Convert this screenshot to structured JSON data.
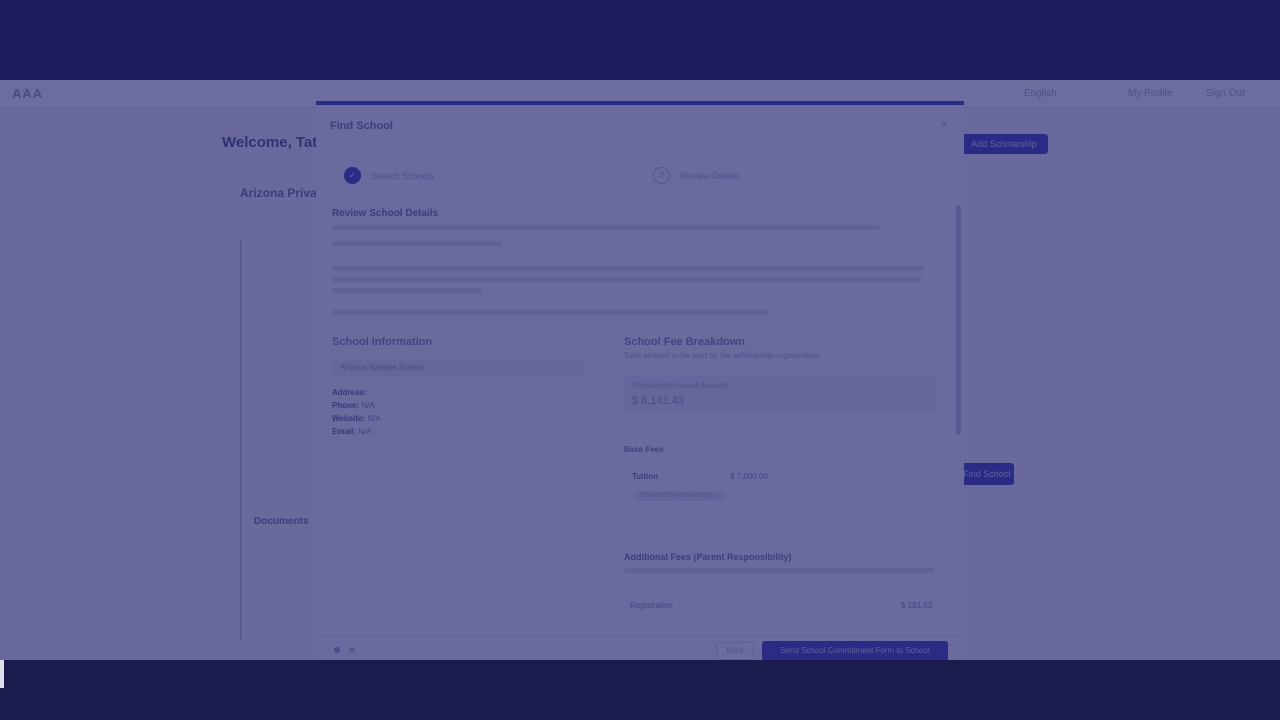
{
  "app": {
    "logo": "AAA",
    "nav": [
      "English",
      "My Profile",
      "Sign Out"
    ],
    "welcome": "Welcome, Tate",
    "add_scholarship_label": "Add Scholarship",
    "find_school_label": "Find School",
    "program_title": "Arizona Private",
    "documents_title": "Documents"
  },
  "modal": {
    "title": "Find School",
    "close": "×",
    "steps": [
      {
        "label": "Search Schools",
        "icon": "✓",
        "state": "done"
      },
      {
        "label": "Review Details",
        "icon": "2",
        "state": "todo"
      }
    ],
    "review_heading": "Review School Details",
    "school_info_title": "School Information",
    "school_name": "Arizona Sample School",
    "info": [
      {
        "label": "Address:",
        "value": ""
      },
      {
        "label": "Phone:",
        "value": "N/A"
      },
      {
        "label": "Website:",
        "value": "N/A"
      },
      {
        "label": "Email:",
        "value": "N/A"
      }
    ],
    "fee_title": "School Fee Breakdown",
    "fee_subtitle": "Total amount to be paid by the scholarship organization",
    "scholarship_label": "Scholarship Award Amount",
    "scholarship_amount": "$ 8,141.43",
    "base_fees_title": "Base Fees",
    "tuition_label": "Tuition",
    "tuition_value": "$ 7,000.00",
    "tuition_note": "Covered by scholarship",
    "additional_fees_title": "Additional Fees (Parent Responsibility)",
    "registration_label": "Registration",
    "registration_value": "$ 181.53",
    "back_label": "Back",
    "primary_label": "Send School Commitment Form to School"
  }
}
